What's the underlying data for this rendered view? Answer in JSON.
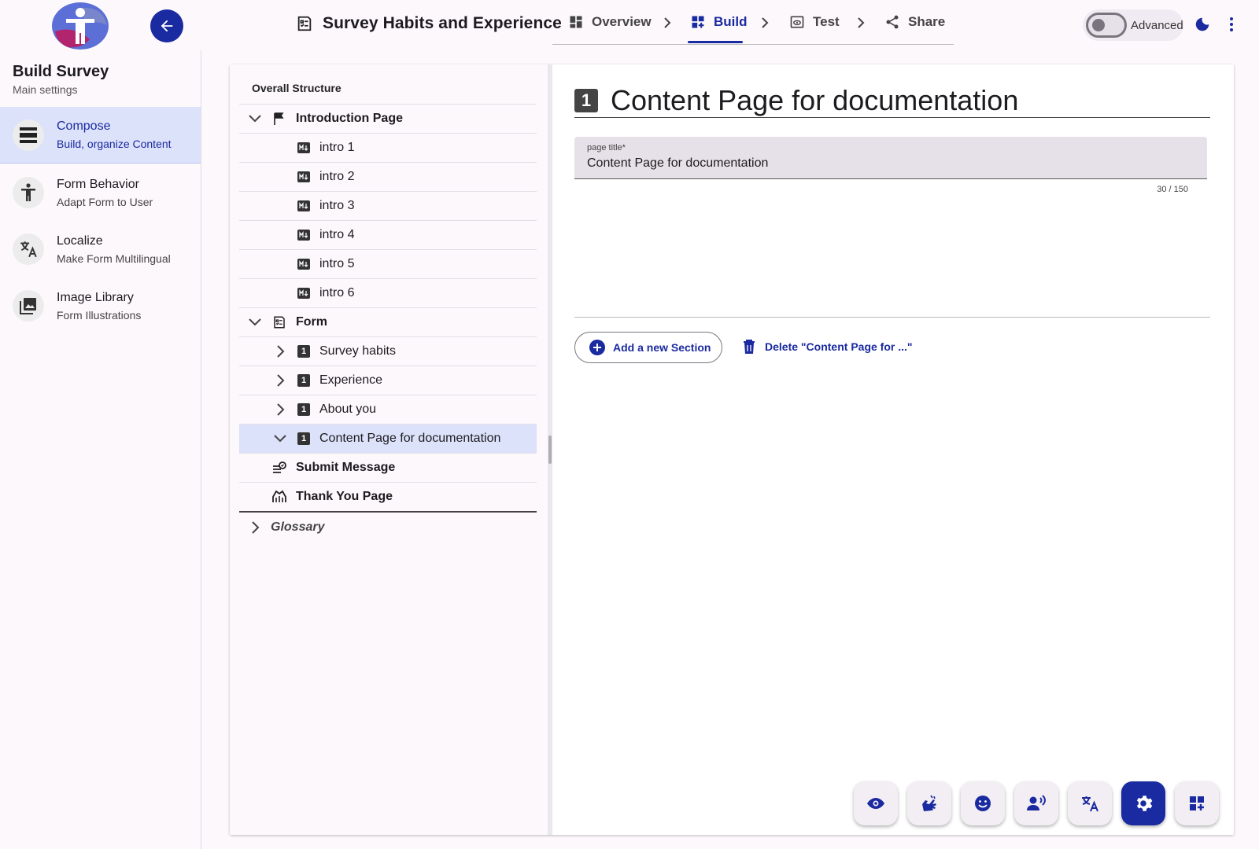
{
  "header": {
    "survey_title": "Survey Habits and Experience",
    "steps": [
      {
        "label": "Overview",
        "icon": "dashboard-icon"
      },
      {
        "label": "Build",
        "icon": "build-grid-icon",
        "active": true
      },
      {
        "label": "Test",
        "icon": "preview-icon"
      },
      {
        "label": "Share",
        "icon": "share-icon"
      }
    ],
    "advanced_label": "Advanced",
    "advanced_on": false
  },
  "sidebar": {
    "title": "Build Survey",
    "subtitle": "Main settings",
    "items": [
      {
        "label": "Compose",
        "desc": "Build, organize Content",
        "icon": "compose-icon",
        "active": true
      },
      {
        "label": "Form Behavior",
        "desc": "Adapt Form to User",
        "icon": "accessibility-icon"
      },
      {
        "label": "Localize",
        "desc": "Make Form Multilingual",
        "icon": "translate-icon"
      },
      {
        "label": "Image Library",
        "desc": "Form Illustrations",
        "icon": "image-library-icon"
      }
    ]
  },
  "tree": {
    "heading": "Overall Structure",
    "intro_page": "Introduction Page",
    "intro_items": [
      "intro 1",
      "intro 2",
      "intro 3",
      "intro 4",
      "intro 5",
      "intro 6"
    ],
    "form": "Form",
    "form_sections": [
      "Survey habits",
      "Experience",
      "About you",
      "Content Page for documentation"
    ],
    "submit_message": "Submit Message",
    "thank_you_page": "Thank You Page",
    "glossary": "Glossary",
    "section_number": "1"
  },
  "content": {
    "page_number": "1",
    "page_heading": "Content Page for documentation",
    "field_label": "page title*",
    "field_value": "Content Page for documentation",
    "counter": "30 / 150",
    "add_section_label": "Add a new Section",
    "delete_label": "Delete \"Content Page for ...\""
  },
  "fabs": [
    {
      "icon": "eye-icon"
    },
    {
      "icon": "sign-language-icon"
    },
    {
      "icon": "smiley-icon"
    },
    {
      "icon": "voice-icon"
    },
    {
      "icon": "translate-icon"
    },
    {
      "icon": "settings-icon",
      "active": true
    },
    {
      "icon": "add-block-icon"
    }
  ],
  "colors": {
    "accent": "#1a2aa0",
    "selected_bg": "#dde2fb",
    "background": "#fdf8fc"
  }
}
